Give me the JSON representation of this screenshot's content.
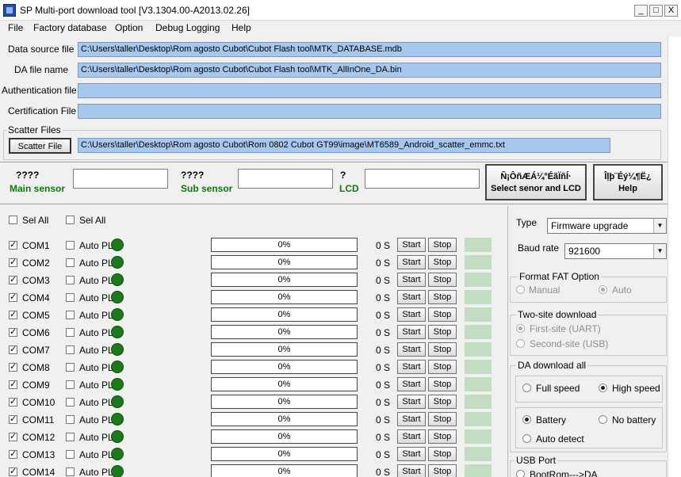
{
  "window": {
    "title": "SP Multi-port download tool [V3.1304.00-A2013.02.26]",
    "min": "_",
    "max": "□",
    "close": "X"
  },
  "menu": [
    "File",
    "Factory database",
    "Option",
    "Debug Logging",
    "Help"
  ],
  "files": {
    "data_source_label": "Data source file",
    "data_source_value": "C:\\Users\\taller\\Desktop\\Rom agosto Cubot\\Cubot Flash tool\\MTK_DATABASE.mdb",
    "da_label": "DA file name",
    "da_value": "C:\\Users\\taller\\Desktop\\Rom agosto Cubot\\Cubot Flash tool\\MTK_AllInOne_DA.bin",
    "auth_label": "Authentication file",
    "auth_value": "",
    "cert_label": "Certification File",
    "cert_value": ""
  },
  "scatter": {
    "group_label": "Scatter Files",
    "button": "Scatter File",
    "value": "C:\\Users\\taller\\Desktop\\Rom agosto Cubot\\Rom 0802 Cubot GT99\\image\\MT6589_Android_scatter_emmc.txt"
  },
  "sensors": {
    "main_q": "????",
    "main_label": "Main sensor",
    "sub_q": "????",
    "sub_label": "Sub sensor",
    "lcd_q": "?",
    "lcd_label": "LCD",
    "select_btn_garbled": "Ñ¡ÔñÆÁ¼°ÉãÏñÍ·",
    "select_btn": "Select senor and LCD",
    "help_btn_garbled": "Îļþ¨Éý¼¶Ë¿",
    "help_btn": "Help"
  },
  "sel_all": [
    "Sel All",
    "Sel All"
  ],
  "ports": {
    "auto_label": "Auto PL",
    "start": "Start",
    "stop": "Stop",
    "rows": [
      {
        "com": "COM1",
        "progress": "0%",
        "time": "0 S"
      },
      {
        "com": "COM2",
        "progress": "0%",
        "time": "0 S"
      },
      {
        "com": "COM3",
        "progress": "0%",
        "time": "0 S"
      },
      {
        "com": "COM4",
        "progress": "0%",
        "time": "0 S"
      },
      {
        "com": "COM5",
        "progress": "0%",
        "time": "0 S"
      },
      {
        "com": "COM6",
        "progress": "0%",
        "time": "0 S"
      },
      {
        "com": "COM7",
        "progress": "0%",
        "time": "0 S"
      },
      {
        "com": "COM8",
        "progress": "0%",
        "time": "0 S"
      },
      {
        "com": "COM9",
        "progress": "0%",
        "time": "0 S"
      },
      {
        "com": "COM10",
        "progress": "0%",
        "time": "0 S"
      },
      {
        "com": "COM11",
        "progress": "0%",
        "time": "0 S"
      },
      {
        "com": "COM12",
        "progress": "0%",
        "time": "0 S"
      },
      {
        "com": "COM13",
        "progress": "0%",
        "time": "0 S"
      },
      {
        "com": "COM14",
        "progress": "0%",
        "time": "0 S"
      }
    ]
  },
  "settings": {
    "type_label": "Type",
    "type_value": "Firmware upgrade",
    "baud_label": "Baud rate",
    "baud_value": "921600",
    "format_fat": {
      "label": "Format FAT Option",
      "manual": "Manual",
      "auto": "Auto"
    },
    "two_site": {
      "label": "Two-site download",
      "first": "First-site (UART)",
      "second": "Second-site (USB)"
    },
    "da_download": {
      "label": "DA download all",
      "full": "Full speed",
      "high": "High speed",
      "battery": "Battery",
      "no_battery": "No battery",
      "auto_detect": "Auto detect"
    },
    "usb_port": {
      "label": "USB Port",
      "bootrom": "BootRom--->DA"
    }
  },
  "colors": {
    "field_bg": "#a6c8ef",
    "status_green": "#c3ddc3",
    "led_green": "#1c7a1c",
    "sensor_label": "#0a7a0a"
  }
}
